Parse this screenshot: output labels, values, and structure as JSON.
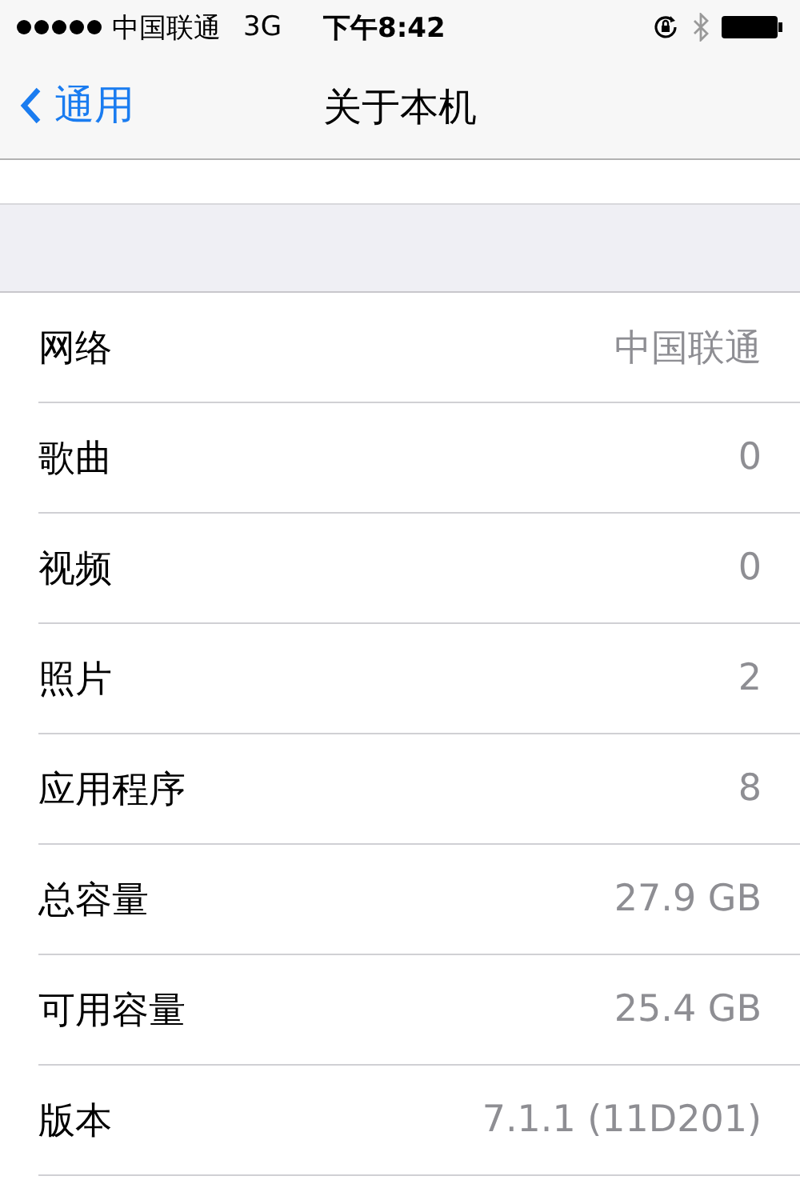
{
  "status_bar": {
    "carrier": "中国联通",
    "network": "3G",
    "time": "下午8:42"
  },
  "nav_bar": {
    "back": "通用",
    "title": "关于本机"
  },
  "rows": [
    {
      "label": "网络",
      "value": "中国联通"
    },
    {
      "label": "歌曲",
      "value": "0"
    },
    {
      "label": "视频",
      "value": "0"
    },
    {
      "label": "照片",
      "value": "2"
    },
    {
      "label": "应用程序",
      "value": "8"
    },
    {
      "label": "总容量",
      "value": "27.9 GB"
    },
    {
      "label": "可用容量",
      "value": "25.4 GB"
    },
    {
      "label": "版本",
      "value": "7.1.1 (11D201)"
    }
  ]
}
